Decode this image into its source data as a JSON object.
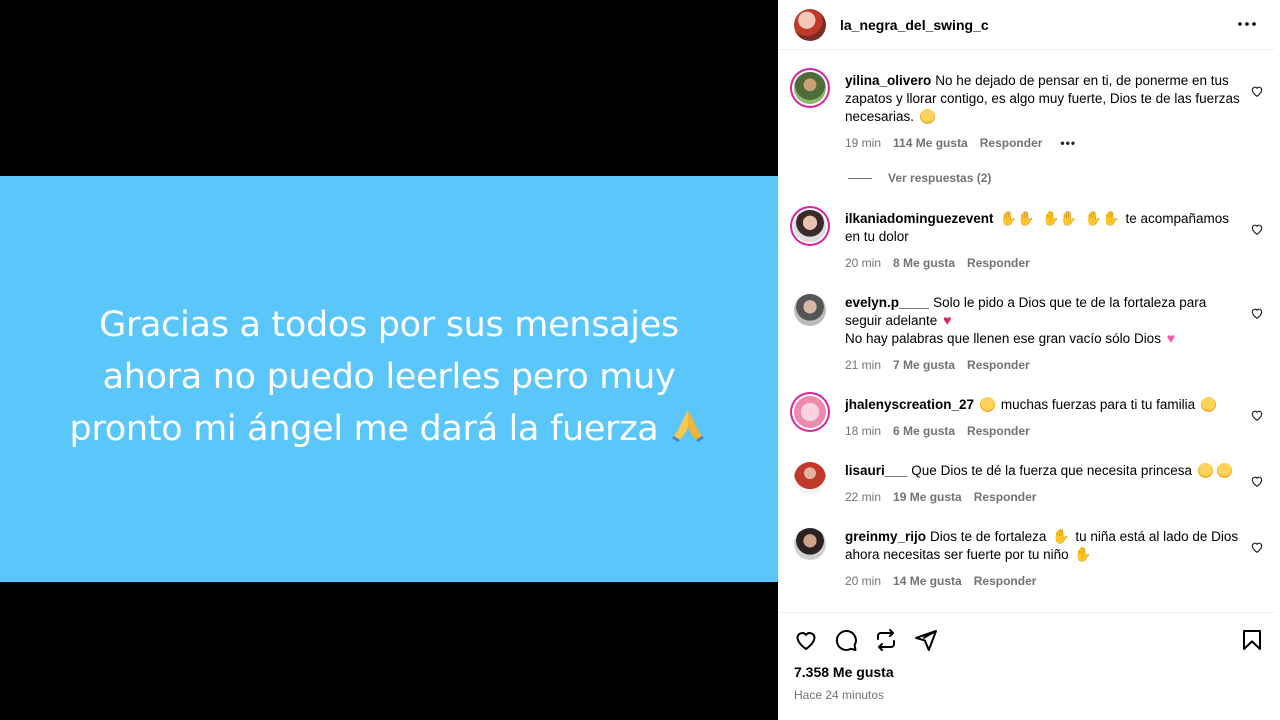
{
  "post": {
    "username": "la_negra_del_swing_c",
    "image_text_lines": [
      "Gracias a todos por sus mensajes",
      "ahora no puedo leerles pero muy",
      "pronto mi ángel me dará la fuerza"
    ],
    "image_bg_color": "#5ac6fa",
    "likes": "7.358 Me gusta",
    "time_ago": "Hace 24 minutos"
  },
  "comments": [
    {
      "user": "yilina_olivero",
      "text": "No he dejado de pensar en ti, de ponerme en tus zapatos y llorar contigo, es algo muy fuerte, Dios te de las fuerzas necesarias.",
      "time": "19 min",
      "likes": "114 Me gusta",
      "reply": "Responder",
      "view_replies": "Ver respuestas (2)"
    },
    {
      "user": "ilkaniadominguezevent",
      "text": "te acompañamos en tu dolor",
      "time": "20 min",
      "likes": "8 Me gusta",
      "reply": "Responder"
    },
    {
      "user": "evelyn.p____",
      "text": "Solo le pido a Dios que te de la fortaleza para seguir adelante",
      "text2": "No hay palabras que llenen ese gran vacío sólo Dios",
      "time": "21 min",
      "likes": "7 Me gusta",
      "reply": "Responder"
    },
    {
      "user": "jhalenyscreation_27",
      "text": "muchas fuerzas para ti tu familia",
      "time": "18 min",
      "likes": "6 Me gusta",
      "reply": "Responder"
    },
    {
      "user": "lisauri___",
      "text": "Que Dios te dé la fuerza que necesita princesa",
      "time": "22 min",
      "likes": "19 Me gusta",
      "reply": "Responder"
    },
    {
      "user": "greinmy_rijo",
      "text": "Dios te de fortaleza",
      "text_b": "tu niña está al lado de Dios ahora necesitas ser fuerte por tu niño",
      "time": "20 min",
      "likes": "14 Me gusta",
      "reply": "Responder"
    }
  ],
  "icons": {
    "more": "more-options-icon",
    "like": "heart-icon",
    "comment": "comment-icon",
    "share": "repost-icon",
    "send": "send-icon",
    "save": "bookmark-icon"
  },
  "colors": {
    "secondary_text": "#737373",
    "story_ring": "#d6249f"
  }
}
